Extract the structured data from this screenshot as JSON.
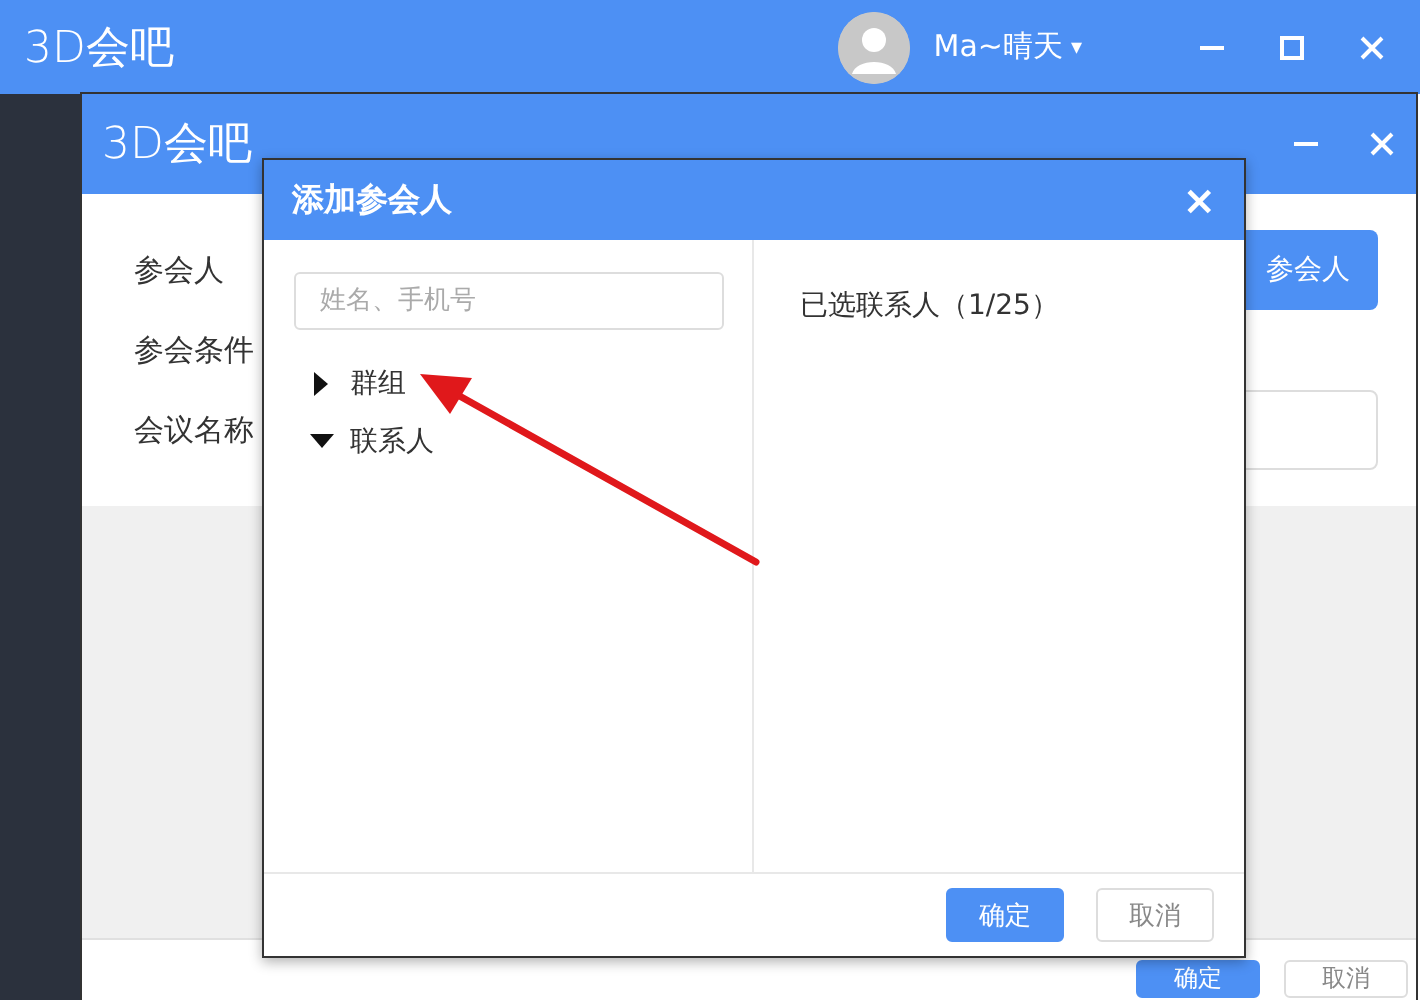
{
  "main_window": {
    "logo": "3D会吧",
    "user_name": "Ma~晴天",
    "caret": "▾"
  },
  "app_window": {
    "logo": "3D会吧",
    "form_labels": [
      "参会人",
      "参会条件",
      "会议名称"
    ],
    "add_button": "参会人",
    "buttons": [
      {
        "label": "确定",
        "kind": "primary"
      },
      {
        "label": "取消",
        "kind": "secondary"
      }
    ]
  },
  "dialog": {
    "title": "添加参会人",
    "close": "×",
    "search": {
      "placeholder": "姓名、手机号"
    },
    "tree": [
      {
        "label": "群组",
        "expanded": false
      },
      {
        "label": "联系人",
        "expanded": true
      }
    ],
    "selected_header": "已选联系人（1/25）",
    "buttons": [
      {
        "label": "确定",
        "kind": "primary"
      },
      {
        "label": "取消",
        "kind": "secondary"
      }
    ]
  }
}
